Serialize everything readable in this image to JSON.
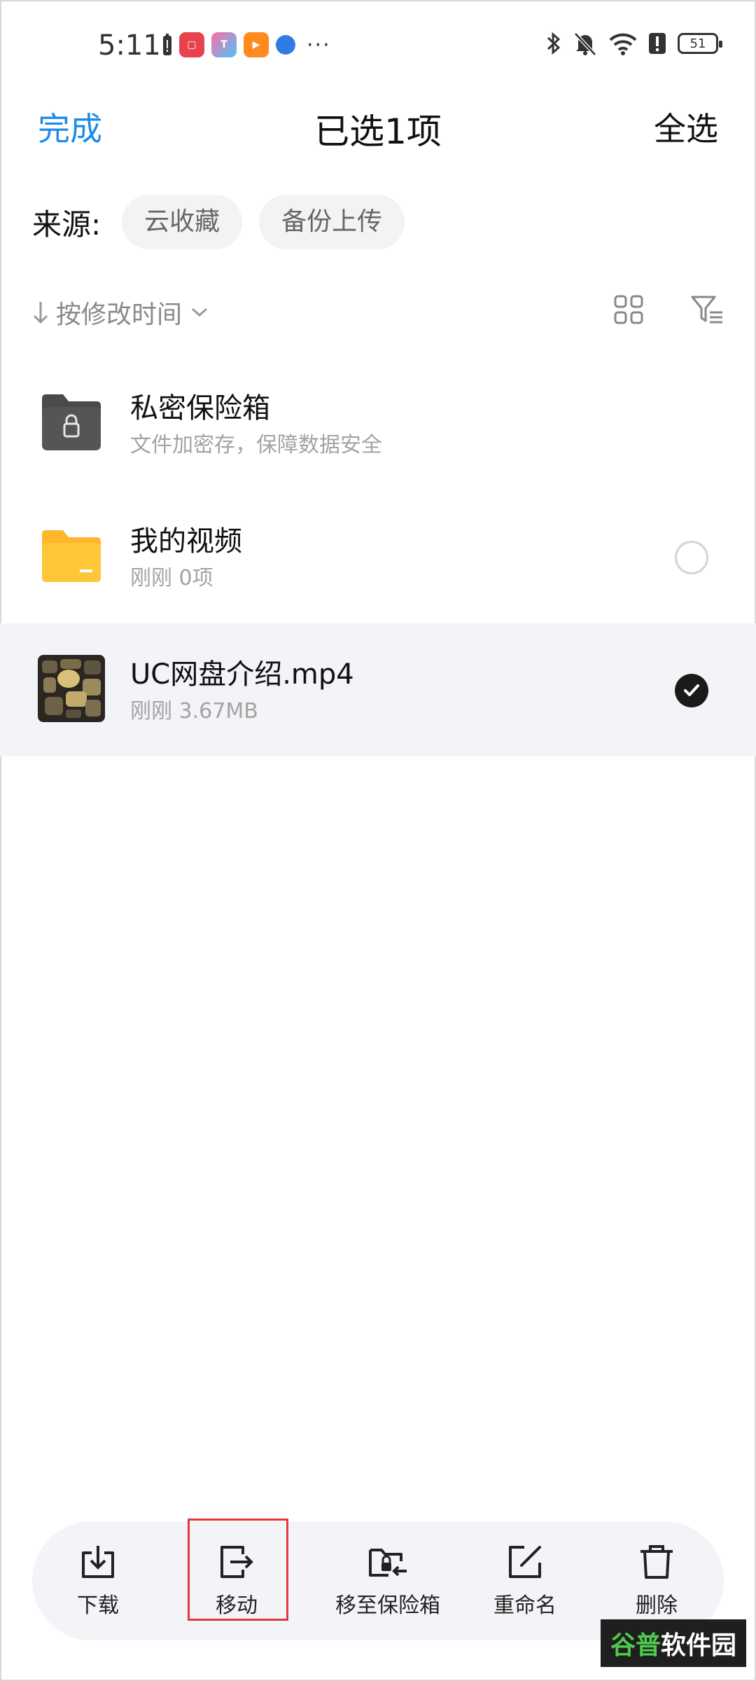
{
  "status_bar": {
    "time": "5:11",
    "battery": "51"
  },
  "header": {
    "done_label": "完成",
    "title": "已选1项",
    "select_all_label": "全选"
  },
  "source": {
    "label": "来源:",
    "chips": [
      "云收藏",
      "备份上传"
    ]
  },
  "sort": {
    "label": "按修改时间"
  },
  "files": [
    {
      "name": "私密保险箱",
      "meta": "文件加密存，保障数据安全",
      "icon": "vault-folder-icon"
    },
    {
      "name": "我的视频",
      "meta": "刚刚  0项",
      "icon": "folder-icon",
      "checked": false
    },
    {
      "name": "UC网盘介绍.mp4",
      "meta": "刚刚  3.67MB",
      "icon": "video-thumbnail",
      "checked": true
    }
  ],
  "actions": [
    {
      "label": "下载",
      "icon": "download-icon"
    },
    {
      "label": "移动",
      "icon": "move-icon"
    },
    {
      "label": "移至保险箱",
      "icon": "move-to-vault-icon"
    },
    {
      "label": "重命名",
      "icon": "rename-icon"
    },
    {
      "label": "删除",
      "icon": "delete-icon"
    }
  ],
  "watermark": {
    "part1": "谷普",
    "part2": "软件园"
  },
  "colors": {
    "accent": "#1c8ce8",
    "highlight": "#e23a3a",
    "folder": "#ffc63a"
  }
}
